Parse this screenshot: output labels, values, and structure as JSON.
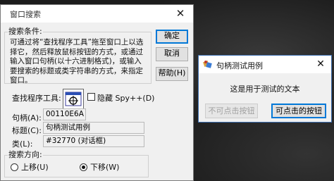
{
  "finder": {
    "title": "窗口搜索",
    "close_glyph": "✕",
    "search_group_label": "搜索条件:",
    "description": "可通过将“查找程序工具”拖至窗口上以选择它，然后释放鼠标按钮的方式，或通过输入窗口句柄(以十六进制格式)，或输入要搜索的标题或类字符串的方式，来指定窗口。",
    "ok_label": "确定",
    "cancel_label": "取消",
    "help_label": "帮助(H)",
    "finder_tool_label": "查找程序工具:",
    "hide_spy_label": "隐藏 Spy++(D)",
    "hide_spy_checked": false,
    "handle_label": "句柄(A):",
    "handle_value": "00110E6A",
    "title_label": "标题(C):",
    "title_value": "句柄测试用例",
    "class_label": "类(L):",
    "class_value": "#32770 (对话框)",
    "direction_group_label": "搜索方向:",
    "up_label": "上移(U)",
    "down_label": "下移(W)",
    "direction_selected": "down"
  },
  "test_dialog": {
    "title": "句柄测试用例",
    "close_glyph": "✕",
    "message": "这是用于测试的文本",
    "disabled_button_label": "不可点击按钮",
    "enabled_button_label": "可点击的按钮",
    "accent_color": "#0078d7"
  }
}
